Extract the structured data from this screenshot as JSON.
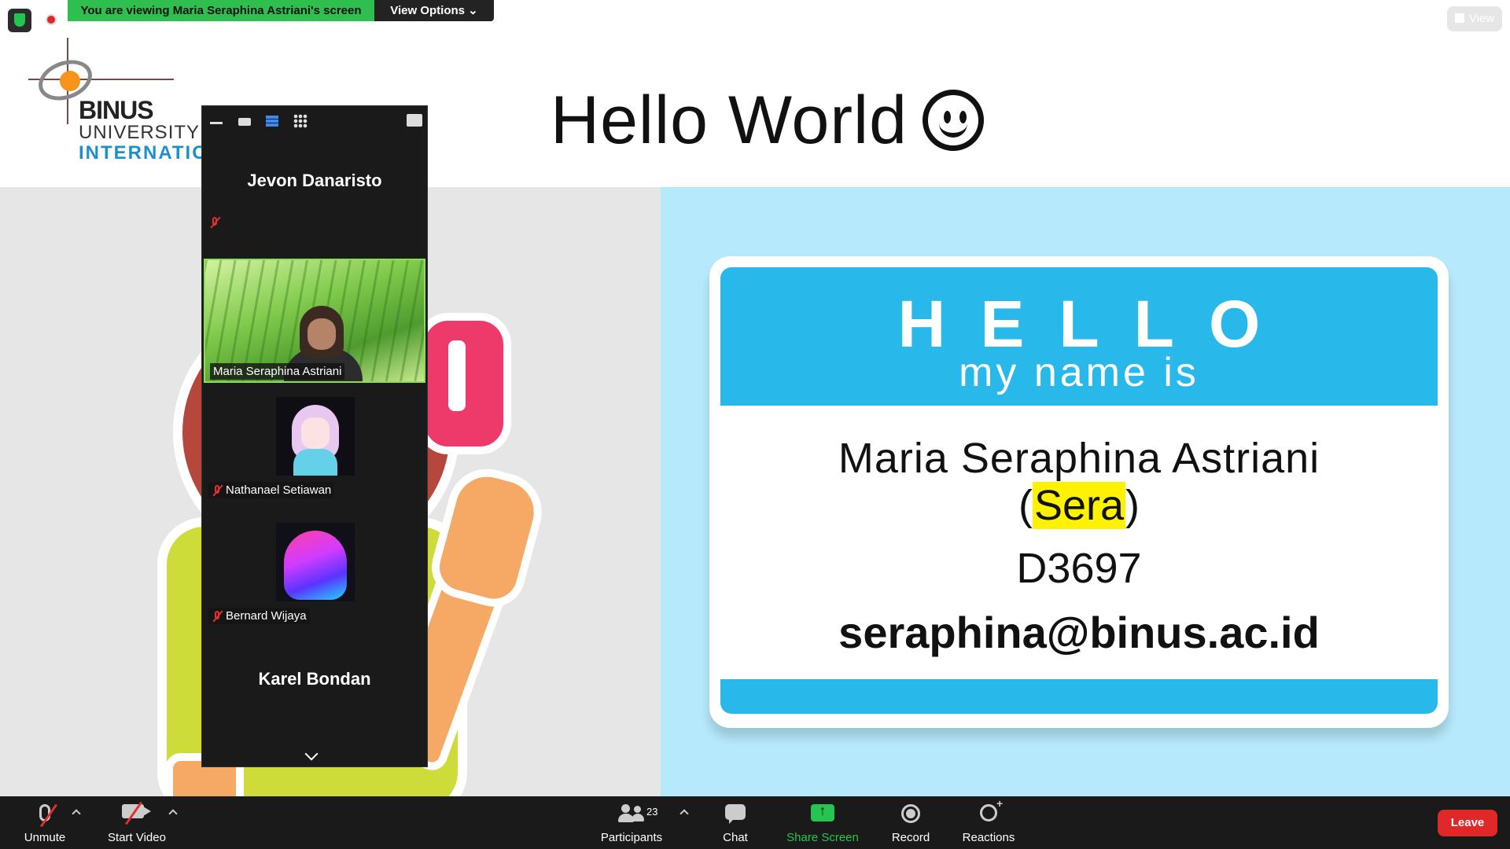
{
  "banner": {
    "viewing_text": "You are viewing Maria Seraphina Astriani's screen",
    "view_options_label": "View Options",
    "view_button_label": "View"
  },
  "slide": {
    "title": "Hello World",
    "logo": {
      "line1": "BINUS",
      "line2": "UNIVERSITY",
      "line3": "INTERNATIONAL"
    },
    "name_tag": {
      "hello": "HELLO",
      "my_name_is": "my name is",
      "full_name": "Maria Seraphina Astriani",
      "open_paren": "(",
      "nickname": "Sera",
      "close_paren": ")",
      "code": "D3697",
      "email": "seraphina@binus.ac.id"
    }
  },
  "participants_panel": {
    "tiles": [
      {
        "name": "Jevon Danaristo",
        "muted": true,
        "video": false
      },
      {
        "name": "Maria Seraphina Astriani",
        "muted": false,
        "video": true,
        "active_speaker": true
      },
      {
        "name": "Nathanael Setiawan",
        "muted": true,
        "video": false
      },
      {
        "name": "Bernard Wijaya",
        "muted": true,
        "video": false
      },
      {
        "name": "Karel Bondan",
        "muted": true,
        "video": false
      }
    ]
  },
  "toolbar": {
    "unmute_label": "Unmute",
    "start_video_label": "Start Video",
    "participants_label": "Participants",
    "participants_count": "23",
    "chat_label": "Chat",
    "share_screen_label": "Share Screen",
    "record_label": "Record",
    "reactions_label": "Reactions",
    "leave_label": "Leave"
  },
  "colors": {
    "banner_green": "#2fbf4f",
    "share_green": "#24c551",
    "leave_red": "#e02828",
    "name_tag_blue": "#28b9ea",
    "highlight_yellow": "#fff200",
    "right_bg": "#b5e9fb"
  }
}
